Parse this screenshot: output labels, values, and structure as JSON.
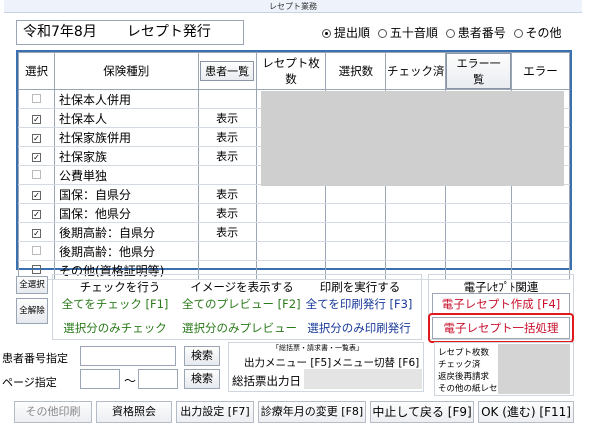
{
  "window_title": "レセプト業務",
  "header": {
    "period": "令和7年8月",
    "mode": "レセプト発行"
  },
  "sort_options": [
    {
      "label": "提出順",
      "selected": true
    },
    {
      "label": "五十音順",
      "selected": false
    },
    {
      "label": "患者番号",
      "selected": false
    },
    {
      "label": "その他",
      "selected": false
    }
  ],
  "table": {
    "columns": {
      "select": "選択",
      "insurance": "保険種別",
      "patient_list": "患者一覧",
      "receipt_count": "レセプト枚数",
      "selected_count": "選択数",
      "checked": "チェック済",
      "error_list": "エラー一覧",
      "error": "エラー"
    },
    "rows": [
      {
        "checked": false,
        "disabled": true,
        "label": "社保本人併用",
        "show": ""
      },
      {
        "checked": true,
        "disabled": false,
        "label": "社保本人",
        "show": "表示"
      },
      {
        "checked": true,
        "disabled": false,
        "label": "社保家族併用",
        "show": "表示"
      },
      {
        "checked": true,
        "disabled": false,
        "label": "社保家族",
        "show": "表示"
      },
      {
        "checked": false,
        "disabled": true,
        "label": "公費単独",
        "show": ""
      },
      {
        "checked": true,
        "disabled": false,
        "label": "国保：自県分",
        "show": "表示"
      },
      {
        "checked": true,
        "disabled": false,
        "label": "国保：他県分",
        "show": "表示"
      },
      {
        "checked": true,
        "disabled": false,
        "label": "後期高齢：自県分",
        "show": "表示"
      },
      {
        "checked": false,
        "disabled": true,
        "label": "後期高齢：他県分",
        "show": ""
      },
      {
        "checked": false,
        "disabled": false,
        "label": "その他(資格証明等)",
        "show": ""
      }
    ]
  },
  "side": {
    "select_all": "全選択",
    "deselect_all": "全解除"
  },
  "actions": {
    "check_header": "チェックを行う",
    "image_header": "イメージを表示する",
    "print_header": "印刷を実行する",
    "check_all": "全てをチェック [F1]",
    "preview_all": "全てのプレビュー [F2]",
    "print_all": "全てを印刷発行 [F3]",
    "check_selected": "選択分のみチェック",
    "preview_selected": "選択分のみプレビュー",
    "print_selected": "選択分のみ印刷発行"
  },
  "electronic": {
    "header": "電子ﾚｾﾌﾟﾄ関連",
    "create": "電子レセプト作成 [F4]",
    "batch": "電子レセプト一括処理"
  },
  "search": {
    "patient_no_label": "患者番号指定",
    "page_label": "ページ指定",
    "tilde": "～",
    "search1": "検索",
    "search2": "検索"
  },
  "summary": {
    "caption": "「総括票・請求書・一覧表」",
    "output_menu": "出力メニュー [F5]",
    "menu_switch": "メニュー切替 [F6]",
    "date_label": "総括票出力日"
  },
  "stats": [
    "レセプト枚数",
    "チェック済",
    "返戻後再請求",
    "その他の紙レセプ"
  ],
  "footer": {
    "other_print": "その他印刷",
    "qualification": "資格照会",
    "output_settings": "出力設定 [F7]",
    "change_month": "診療年月の変更 [F8]",
    "cancel_back": "中止して戻る [F9]",
    "ok_next": "OK (進む) [F11]"
  },
  "colors": {
    "accent_border": "#3a6fb0",
    "electronic_text": "#c8102e",
    "action_text": "#2a7a1a",
    "link_text": "#1a3a9a",
    "highlight": "#e0191c"
  }
}
